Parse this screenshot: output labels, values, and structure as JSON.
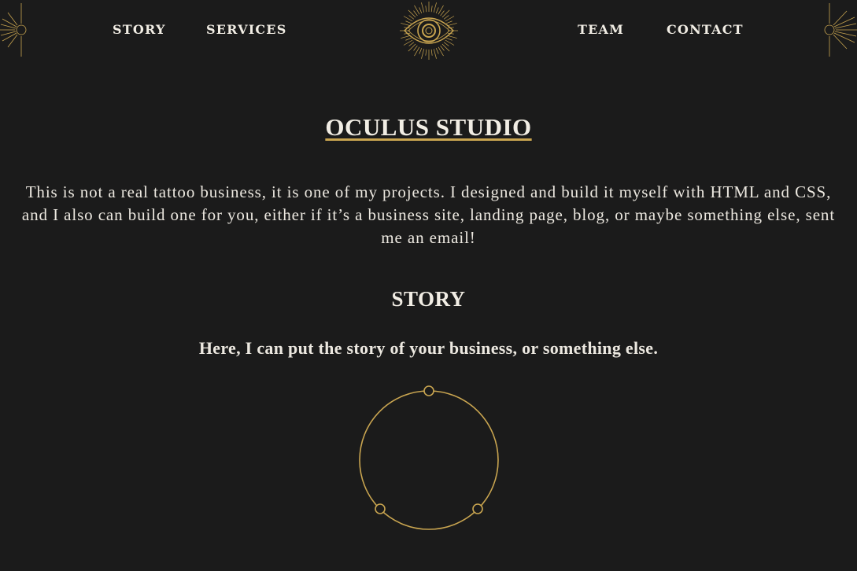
{
  "nav": {
    "left": [
      "STORY",
      "SERVICES"
    ],
    "right": [
      "TEAM",
      "CONTACT"
    ]
  },
  "icons": {
    "logo": "eye-sunburst-icon",
    "corner_left": "sun-ray-icon",
    "corner_right": "sun-ray-icon",
    "story_graphic": "circle-orbit-icon"
  },
  "colors": {
    "background": "#1b1b1b",
    "accent": "#c9a550",
    "text": "#ece8e0"
  },
  "hero": {
    "title": "OCULUS STUDIO",
    "intro": "This is not a real tattoo business, it is one of my projects. I designed and build it myself with HTML and CSS, and I also can build one for you, either if it’s a business site, landing page, blog, or maybe something else, sent me an email!"
  },
  "story": {
    "heading": "STORY",
    "subheading": "Here, I can put the story of your business, or something else."
  }
}
